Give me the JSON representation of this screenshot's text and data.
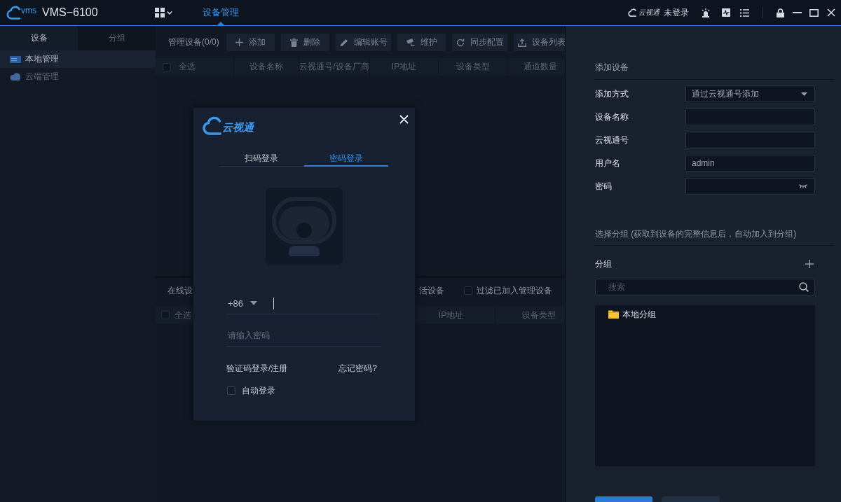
{
  "title_bar": {
    "logo_text": "vms",
    "app_name": "VMS−6100",
    "nav_tabs": [
      {
        "label": "设备管理",
        "selected": true
      }
    ],
    "cloud_logo_text": "云视通",
    "login_status": "未登录"
  },
  "sidebar": {
    "tabs": [
      {
        "label": "设备",
        "selected": true
      },
      {
        "label": "分组",
        "selected": false
      }
    ],
    "items": [
      {
        "label": "本地管理",
        "kind": "local",
        "selected": true
      },
      {
        "label": "云端管理",
        "kind": "cloud",
        "selected": false
      }
    ]
  },
  "managed_devices": {
    "title": "管理设备(0/0)",
    "buttons": [
      {
        "kind": "add",
        "label": "添加"
      },
      {
        "kind": "delete",
        "label": "删除"
      },
      {
        "kind": "edit",
        "label": "编辑账号"
      },
      {
        "kind": "maintain",
        "label": "维护"
      },
      {
        "kind": "sync",
        "label": "同步配置"
      },
      {
        "kind": "export",
        "label": "设备列表"
      }
    ],
    "select_all": {
      "label": "全选",
      "checked": false
    },
    "columns": [
      "设备名称",
      "云视通号/设备厂商",
      "IP地址",
      "设备类型",
      "通道数量"
    ]
  },
  "online_devices": {
    "title": "在线设",
    "action_button": "活设备",
    "filter": {
      "label": "过滤已加入管理设备",
      "checked": false
    },
    "select_all": {
      "label": "全选",
      "checked": false
    },
    "columns": [
      "IP地址",
      "设备类型"
    ]
  },
  "login_dialog": {
    "logo_text": "云视通",
    "tabs": [
      {
        "label": "扫码登录",
        "selected": false
      },
      {
        "label": "密码登录",
        "selected": true
      }
    ],
    "phone": {
      "country_code": "+86",
      "focused": true
    },
    "password": {
      "placeholder": "请输入密码"
    },
    "links": [
      "验证码登录/注册",
      "忘记密码?"
    ],
    "auto_login": {
      "label": "自动登录",
      "checked": false
    }
  },
  "add_device_panel": {
    "title": "添加设备",
    "fields": [
      {
        "label": "添加方式",
        "kind": "select",
        "value": "通过云视通号添加"
      },
      {
        "label": "设备名称",
        "kind": "text"
      },
      {
        "label": "云视通号",
        "kind": "text"
      },
      {
        "label": "用户名",
        "kind": "text",
        "value": "admin"
      },
      {
        "label": "密码",
        "kind": "password"
      }
    ],
    "group_hint": "选择分组 (获取到设备的完整信息后，自动加入到分组)",
    "group_title": "分组",
    "search": {
      "placeholder": "搜索"
    },
    "tree": [
      {
        "label": "本地分组"
      }
    ],
    "actions": [
      {
        "kind": "primary"
      },
      {
        "kind": "secondary"
      }
    ]
  }
}
